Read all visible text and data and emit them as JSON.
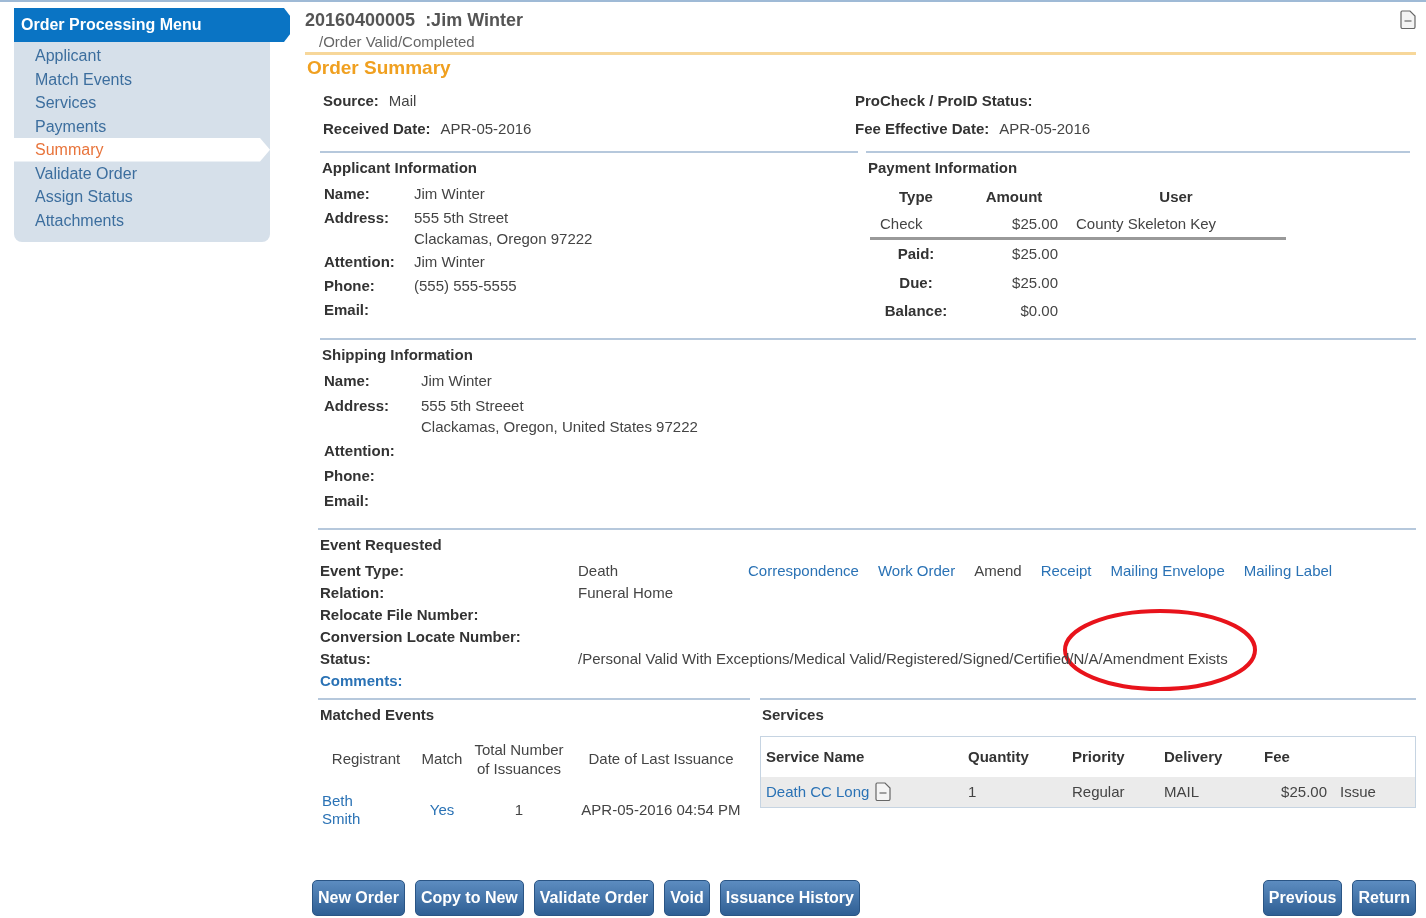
{
  "sidebar": {
    "title": "Order Processing Menu",
    "items": [
      {
        "label": "Applicant",
        "selected": false
      },
      {
        "label": "Match Events",
        "selected": false
      },
      {
        "label": "Services",
        "selected": false
      },
      {
        "label": "Payments",
        "selected": false
      },
      {
        "label": "Summary",
        "selected": true
      },
      {
        "label": "Validate Order",
        "selected": false
      },
      {
        "label": "Assign Status",
        "selected": false
      },
      {
        "label": "Attachments",
        "selected": false
      }
    ]
  },
  "header": {
    "order_number": "20160400005",
    "name": ":Jim Winter",
    "status": "/Order Valid/Completed"
  },
  "section_title": "Order Summary",
  "summary_left": [
    {
      "label": "Source:",
      "value": "Mail"
    },
    {
      "label": "Received Date:",
      "value": "APR-05-2016"
    }
  ],
  "summary_right": [
    {
      "label": "ProCheck / ProID Status:"
    },
    {
      "label": "Fee Effective Date:",
      "value": "APR-05-2016"
    }
  ],
  "applicant": {
    "title": "Applicant Information",
    "fields": [
      {
        "label": "Name:",
        "lines": [
          "Jim Winter"
        ]
      },
      {
        "label": "Address:",
        "lines": [
          "555 5th Street",
          "Clackamas, Oregon 97222"
        ]
      },
      {
        "label": "Attention:",
        "lines": [
          "Jim Winter"
        ]
      },
      {
        "label": "Phone:",
        "lines": [
          "(555) 555-5555"
        ]
      },
      {
        "label": "Email:"
      }
    ]
  },
  "payment": {
    "title": "Payment Information",
    "columns": [
      "Type",
      "Amount",
      "User"
    ],
    "rows": [
      [
        "Check",
        "$25.00",
        "County Skeleton Key"
      ]
    ],
    "totals": [
      {
        "label": "Paid:",
        "value": "$25.00"
      },
      {
        "label": "Due:",
        "value": "$25.00"
      },
      {
        "label": "Balance:",
        "value": "$0.00"
      }
    ]
  },
  "shipping": {
    "title": "Shipping Information",
    "fields": [
      {
        "label": "Name:",
        "lines": [
          "Jim Winter"
        ]
      },
      {
        "label": "Address:",
        "lines": [
          "555 5th Streeet",
          "Clackamas, Oregon, United States 97222"
        ]
      },
      {
        "label": "Attention:"
      },
      {
        "label": "Phone:"
      },
      {
        "label": "Email:"
      }
    ]
  },
  "event": {
    "title": "Event Requested",
    "fields": [
      {
        "label": "Event Type:",
        "value": "Death",
        "kind": "text"
      },
      {
        "label": "Relation:",
        "value": "Funeral Home",
        "kind": "text"
      },
      {
        "label": "Relocate File Number:",
        "kind": "text"
      },
      {
        "label": "Conversion Locate Number:",
        "kind": "text"
      },
      {
        "label": "Status:",
        "value": "/Personal Valid With Exceptions/Medical Valid/Registered/Signed/Certified/N/A/Amendment Exists",
        "kind": "status"
      },
      {
        "label": "Comments:",
        "kind": "link"
      }
    ],
    "links": [
      {
        "label": "Correspondence",
        "kind": "link"
      },
      {
        "label": "Work Order",
        "kind": "link"
      },
      {
        "label": "Amend",
        "kind": "text"
      },
      {
        "label": "Receipt",
        "kind": "link"
      },
      {
        "label": "Mailing Envelope",
        "kind": "link"
      },
      {
        "label": "Mailing Label",
        "kind": "link"
      }
    ]
  },
  "matched_events": {
    "title": "Matched Events",
    "columns": [
      "Registrant",
      "Match",
      "Total Number of Issuances",
      "Date of Last Issuance"
    ],
    "rows": [
      [
        "Beth Smith",
        "Yes",
        "1",
        "APR-05-2016 04:54 PM"
      ]
    ]
  },
  "services": {
    "title": "Services",
    "columns": [
      "Service Name",
      "Quantity",
      "Priority",
      "Delivery",
      "Fee"
    ],
    "rows": [
      {
        "name": "Death CC Long",
        "quantity": "1",
        "priority": "Regular",
        "delivery": "MAIL",
        "fee": "$25.00",
        "action": "Issue"
      }
    ]
  },
  "buttons_left": [
    "New Order",
    "Copy to New",
    "Validate Order",
    "Void",
    "Issuance History"
  ],
  "buttons_right": [
    "Previous",
    "Return"
  ]
}
